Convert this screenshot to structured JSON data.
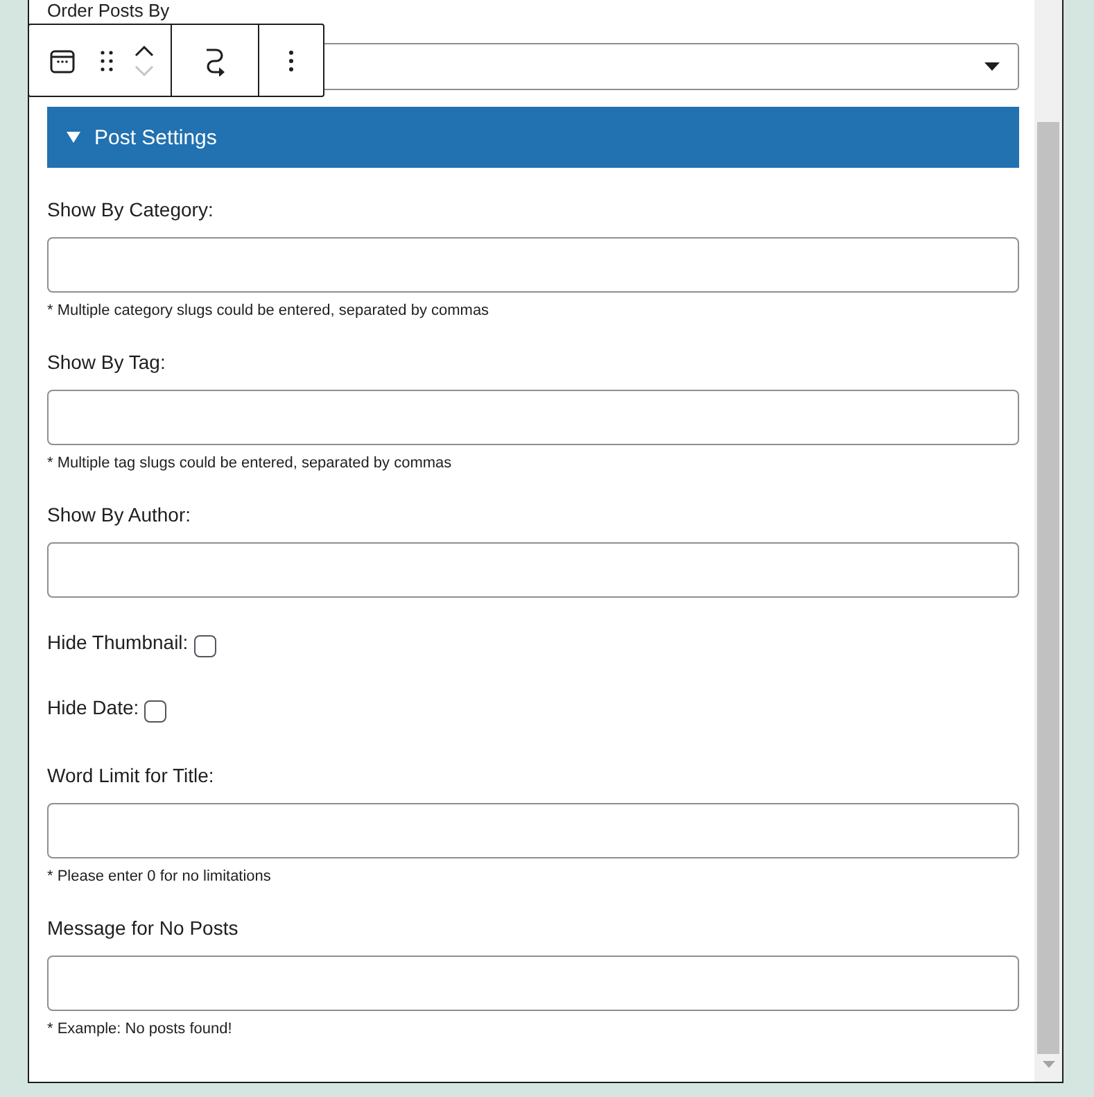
{
  "order_posts_by": {
    "label": "Order Posts By"
  },
  "toolbar": {
    "items": [
      {
        "kind": "calendar"
      },
      {
        "kind": "drag"
      },
      {
        "kind": "move"
      },
      {
        "kind": "transform"
      },
      {
        "kind": "more"
      }
    ]
  },
  "section": {
    "title": "Post Settings",
    "expanded": true
  },
  "fields": [
    {
      "kind": "text",
      "label": "Show By Category:",
      "help": "* Multiple category slugs could be entered, separated by commas"
    },
    {
      "kind": "text",
      "label": "Show By Tag:",
      "help": "* Multiple tag slugs could be entered, separated by commas"
    },
    {
      "kind": "text",
      "label": "Show By Author:"
    },
    {
      "kind": "checkbox",
      "label": "Hide Thumbnail:",
      "checked": false
    },
    {
      "kind": "checkbox",
      "label": "Hide Date:",
      "checked": false
    },
    {
      "kind": "text",
      "label": "Word Limit for Title:",
      "help": "* Please enter 0 for no limitations"
    },
    {
      "kind": "text",
      "label": "Message for No Posts",
      "help": "* Example: No posts found!"
    }
  ]
}
